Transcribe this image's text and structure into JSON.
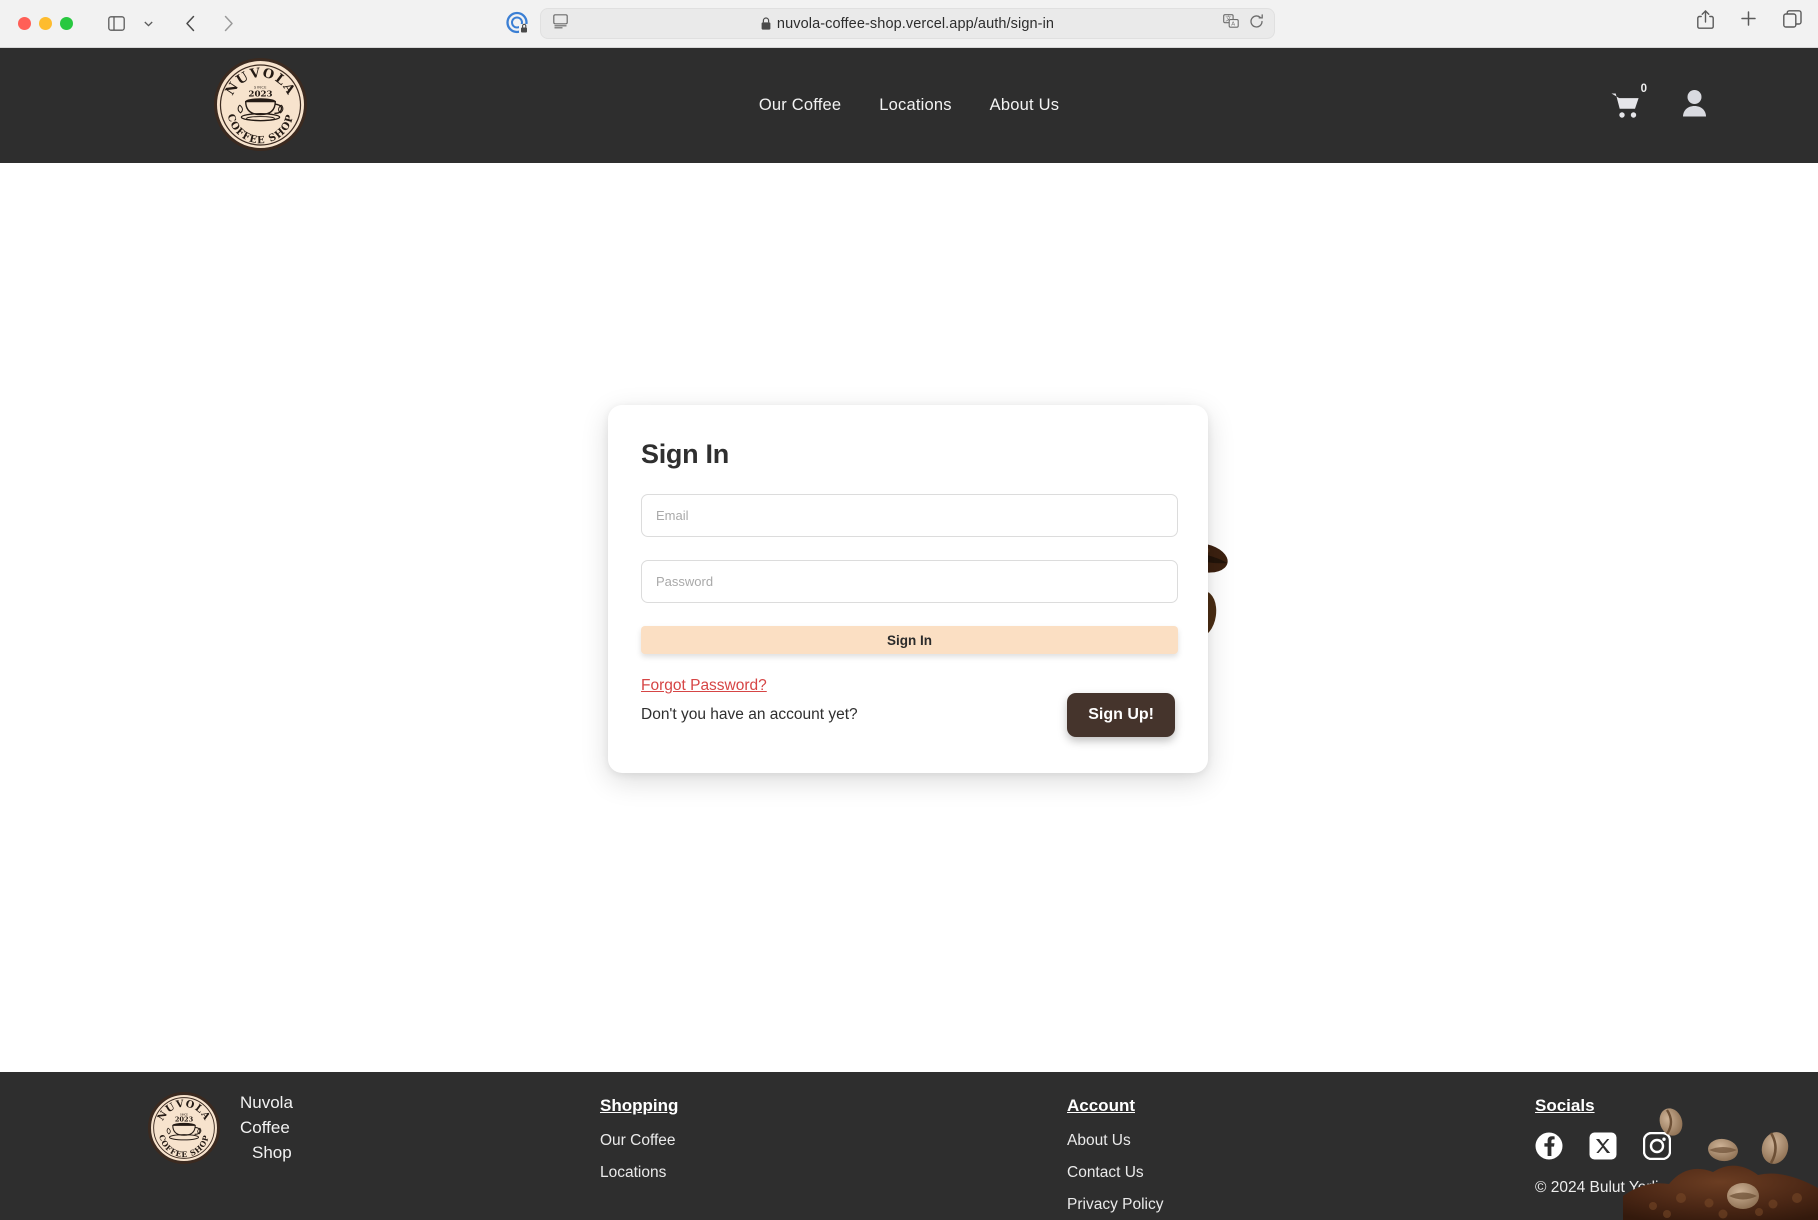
{
  "browser": {
    "url": "nuvola-coffee-shop.vercel.app/auth/sign-in",
    "icons": {
      "sidebar": "sidebar-toggle-icon",
      "chevron": "chevron-down-icon",
      "back": "back-arrow-icon",
      "forward": "forward-arrow-icon",
      "shield": "privacy-shield-icon",
      "reader": "reader-view-icon",
      "lock": "lock-icon",
      "translate": "translate-icon",
      "reload": "reload-icon",
      "share": "share-icon",
      "newtab": "new-tab-icon",
      "tabs": "tab-overview-icon"
    }
  },
  "header": {
    "logo": {
      "top_text": "NUVOLA",
      "since_text": "SINCE",
      "year": "2023",
      "bottom_text": "COFFEE SHOP"
    },
    "nav": [
      {
        "label": "Our Coffee"
      },
      {
        "label": "Locations"
      },
      {
        "label": "About Us"
      }
    ],
    "cart_count": "0",
    "cart_icon": "shopping-cart-icon",
    "account_icon": "user-account-icon"
  },
  "signin": {
    "title": "Sign In",
    "email_placeholder": "Email",
    "email_value": "",
    "password_placeholder": "Password",
    "password_value": "",
    "submit_label": "Sign In",
    "forgot_label": "Forgot Password?",
    "no_account_text": "Don't you have an account yet?",
    "signup_label": "Sign Up!"
  },
  "footer": {
    "brand": {
      "line1": "Nuvola",
      "line2": "Coffee",
      "line3": "Shop"
    },
    "columns": [
      {
        "title": "Shopping",
        "links": [
          {
            "label": "Our Coffee"
          },
          {
            "label": "Locations"
          }
        ]
      },
      {
        "title": "Account",
        "links": [
          {
            "label": "About Us"
          },
          {
            "label": "Contact Us"
          },
          {
            "label": "Privacy Policy"
          }
        ]
      }
    ],
    "socials": {
      "title": "Socials",
      "items": [
        {
          "name": "facebook-icon"
        },
        {
          "name": "x-twitter-icon"
        },
        {
          "name": "instagram-icon"
        }
      ]
    },
    "copyright": "© 2024 Bulut Yerli"
  },
  "colors": {
    "header_bg": "#2e2e2e",
    "footer_bg": "#2e2e2e",
    "accent_button": "#fbdfc3",
    "signup_button": "#45342c",
    "forgot_link": "#d64545",
    "logo_cream": "#f7e3cd"
  }
}
